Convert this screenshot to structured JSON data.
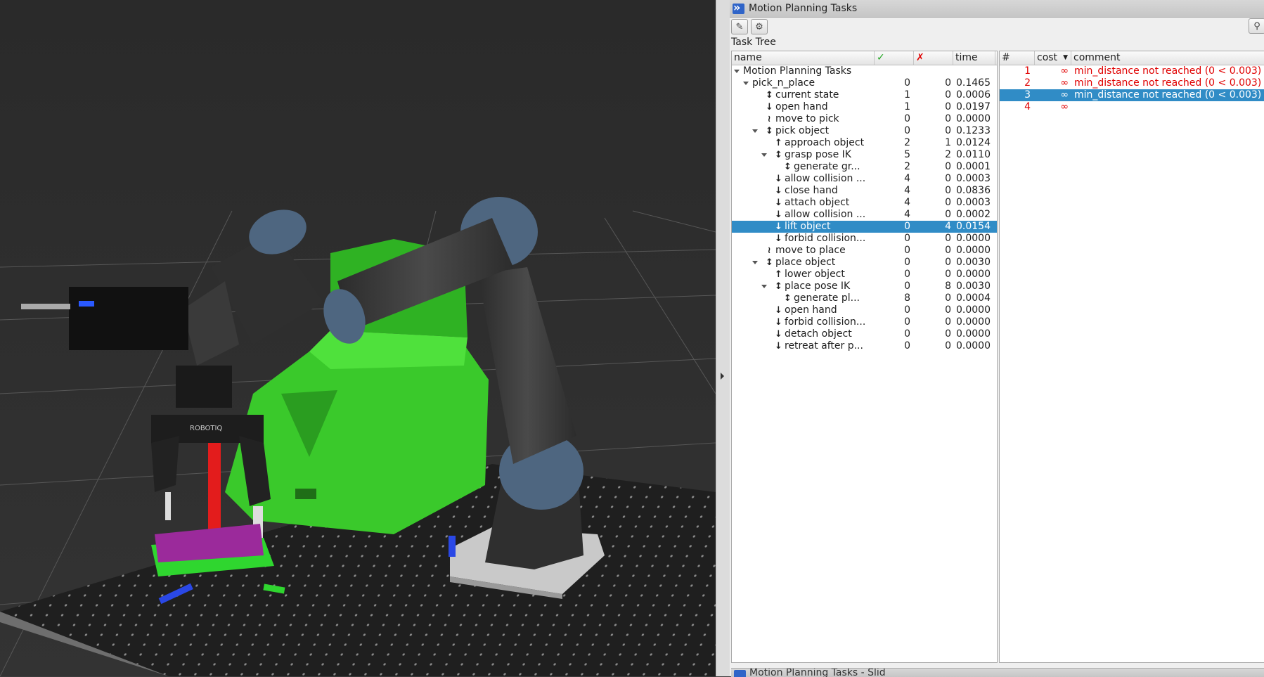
{
  "panel": {
    "title": "Motion Planning Tasks",
    "section_label": "Task Tree",
    "bottom_dock_title": "Motion Planning Tasks - Slid",
    "toolbar": {
      "edit_icon": "edit-icon",
      "settings_icon": "gear-icon"
    }
  },
  "tree": {
    "headers": {
      "name": "name",
      "success": "✓",
      "failure": "✗",
      "time": "time"
    },
    "header_colors": {
      "success": "#1fa51f",
      "failure": "#e00000"
    },
    "rows": [
      {
        "label": "Motion Planning Tasks",
        "ok": "",
        "fail": "",
        "time": "",
        "icon": ""
      },
      {
        "label": "pick_n_place",
        "ok": "0",
        "fail": "0",
        "time": "0.1465",
        "icon": ""
      },
      {
        "label": "current state",
        "ok": "1",
        "fail": "0",
        "time": "0.0006",
        "icon": "generator"
      },
      {
        "label": "open hand",
        "ok": "1",
        "fail": "0",
        "time": "0.0197",
        "icon": "propagate-down"
      },
      {
        "label": "move to pick",
        "ok": "0",
        "fail": "0",
        "time": "0.0000",
        "icon": "connect"
      },
      {
        "label": "pick object",
        "ok": "0",
        "fail": "0",
        "time": "0.1233",
        "icon": "generator"
      },
      {
        "label": "approach object",
        "ok": "2",
        "fail": "1",
        "time": "0.0124",
        "icon": "propagate-up"
      },
      {
        "label": "grasp pose IK",
        "ok": "5",
        "fail": "2",
        "time": "0.0110",
        "icon": "generator"
      },
      {
        "label": "generate gr...",
        "ok": "2",
        "fail": "0",
        "time": "0.0001",
        "icon": "generator"
      },
      {
        "label": "allow collision ...",
        "ok": "4",
        "fail": "0",
        "time": "0.0003",
        "icon": "propagate-down"
      },
      {
        "label": "close hand",
        "ok": "4",
        "fail": "0",
        "time": "0.0836",
        "icon": "propagate-down"
      },
      {
        "label": "attach object",
        "ok": "4",
        "fail": "0",
        "time": "0.0003",
        "icon": "propagate-down"
      },
      {
        "label": "allow collision ...",
        "ok": "4",
        "fail": "0",
        "time": "0.0002",
        "icon": "propagate-down"
      },
      {
        "label": "lift object",
        "ok": "0",
        "fail": "4",
        "time": "0.0154",
        "icon": "propagate-down"
      },
      {
        "label": "forbid collision...",
        "ok": "0",
        "fail": "0",
        "time": "0.0000",
        "icon": "propagate-down"
      },
      {
        "label": "move to place",
        "ok": "0",
        "fail": "0",
        "time": "0.0000",
        "icon": "connect"
      },
      {
        "label": "place object",
        "ok": "0",
        "fail": "0",
        "time": "0.0030",
        "icon": "generator"
      },
      {
        "label": "lower object",
        "ok": "0",
        "fail": "0",
        "time": "0.0000",
        "icon": "propagate-up"
      },
      {
        "label": "place pose IK",
        "ok": "0",
        "fail": "8",
        "time": "0.0030",
        "icon": "generator"
      },
      {
        "label": "generate pl...",
        "ok": "8",
        "fail": "0",
        "time": "0.0004",
        "icon": "generator"
      },
      {
        "label": "open hand",
        "ok": "0",
        "fail": "0",
        "time": "0.0000",
        "icon": "propagate-down"
      },
      {
        "label": "forbid collision...",
        "ok": "0",
        "fail": "0",
        "time": "0.0000",
        "icon": "propagate-down"
      },
      {
        "label": "detach object",
        "ok": "0",
        "fail": "0",
        "time": "0.0000",
        "icon": "propagate-down"
      },
      {
        "label": "retreat after p...",
        "ok": "0",
        "fail": "0",
        "time": "0.0000",
        "icon": "propagate-down"
      }
    ],
    "selected_label": "lift object"
  },
  "solutions": {
    "headers": {
      "num": "#",
      "cost": "cost",
      "comment": "comment"
    },
    "rows": [
      {
        "num": "1",
        "cost": "∞",
        "comment": "min_distance not reached (0 < 0.003)"
      },
      {
        "num": "2",
        "cost": "∞",
        "comment": "min_distance not reached (0 < 0.003)"
      },
      {
        "num": "3",
        "cost": "∞",
        "comment": "min_distance not reached (0 < 0.003)"
      },
      {
        "num": "4",
        "cost": "∞",
        "comment": ""
      }
    ],
    "error_color": "#e00000",
    "selection_color": "#308cc6"
  },
  "viewport": {
    "robot_model_text": "ROBOTIQ",
    "colors": {
      "background": "#303030",
      "object_green": "#39d12a",
      "table": "#222222",
      "robot_dark": "#3a3a3a",
      "robot_caps": "#4e6680"
    }
  }
}
